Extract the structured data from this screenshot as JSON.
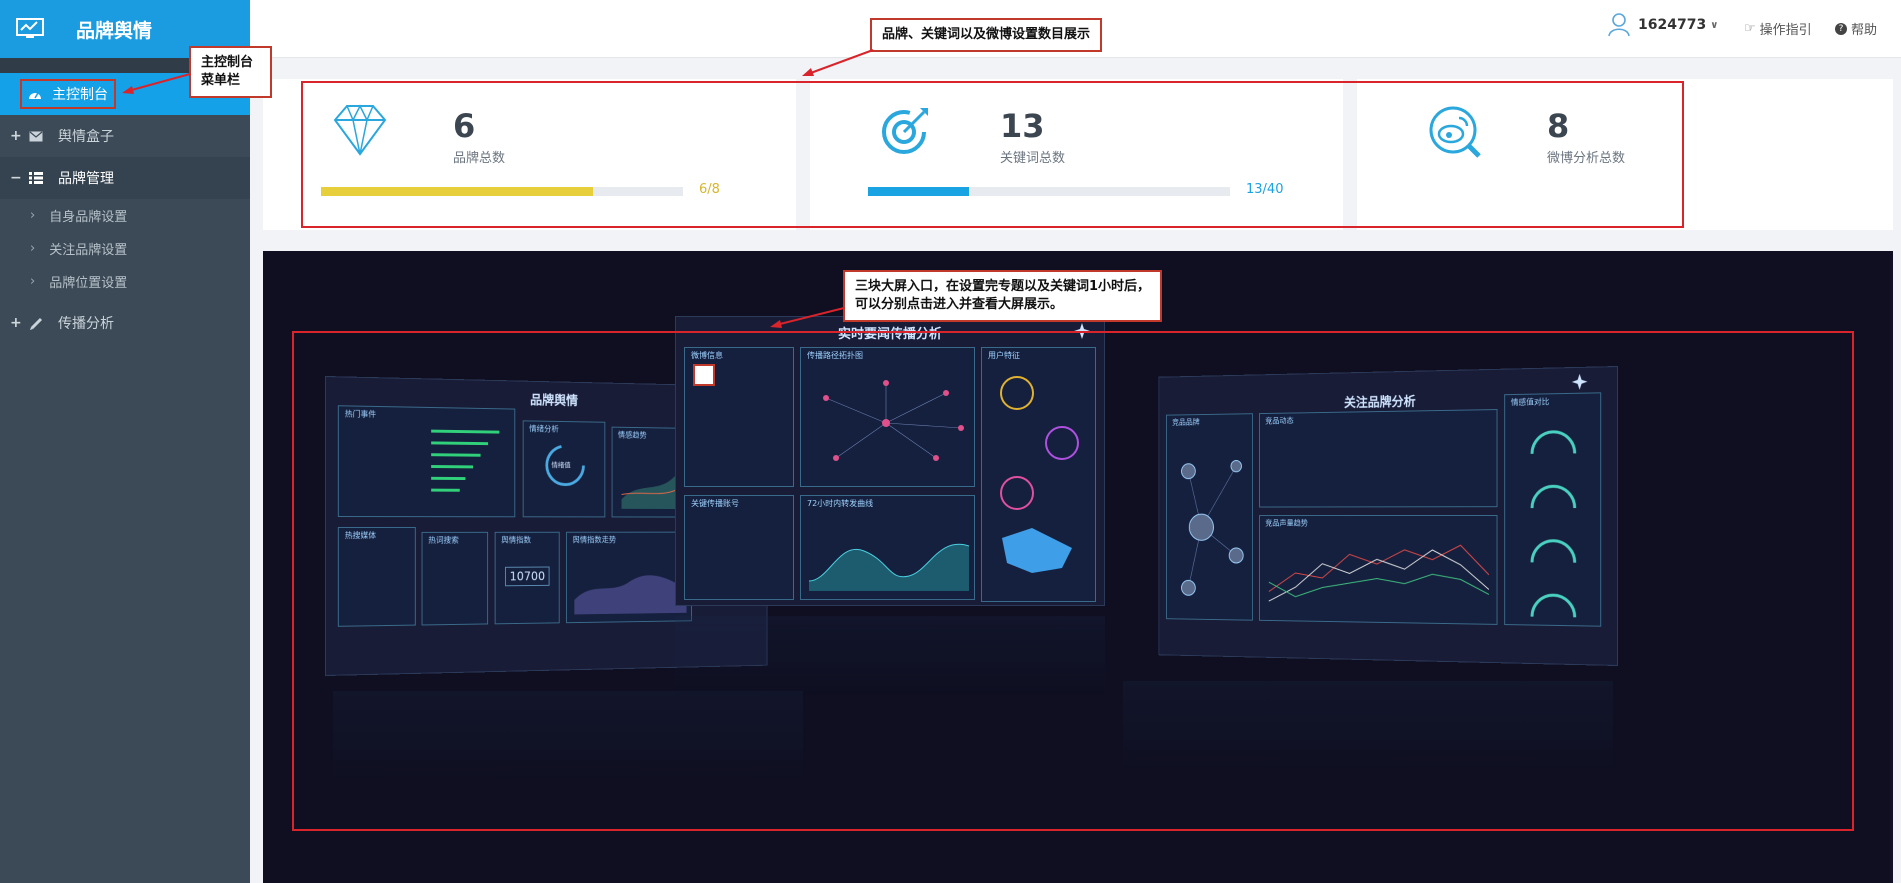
{
  "app": {
    "title": "品牌舆情"
  },
  "sidebar": {
    "items": [
      {
        "label": "主控制台",
        "active": true
      },
      {
        "label": "舆情盒子",
        "sign": "+"
      },
      {
        "label": "品牌管理",
        "sign": "−",
        "children": [
          "自身品牌设置",
          "关注品牌设置",
          "品牌位置设置"
        ]
      },
      {
        "label": "传播分析",
        "sign": "+"
      }
    ]
  },
  "header": {
    "user": "1624773",
    "guide_label": "操作指引",
    "help_label": "帮助"
  },
  "stats": [
    {
      "value": "6",
      "label": "品牌总数",
      "ratio": "6/8",
      "progress": 0.75,
      "color": "#e6cf3a",
      "ratio_color": "#d7b62d"
    },
    {
      "value": "13",
      "label": "关键词总数",
      "ratio": "13/40",
      "progress": 0.28,
      "color": "#1aa3e2",
      "ratio_color": "#1aa3e2"
    },
    {
      "value": "8",
      "label": "微博分析总数"
    }
  ],
  "annotations": {
    "sidebar_note": [
      "主控制台",
      "菜单栏"
    ],
    "stats_note": "品牌、关键词以及微博设置数目展示",
    "screens_note": [
      "三块大屏入口，在设置完专题以及关键词1小时后，",
      "可以分别点击进入并查看大屏展示。"
    ]
  },
  "screens": [
    {
      "title": "品牌舆情",
      "panels": [
        "热门事件",
        "情绪分析",
        "情感趋势",
        "热搜媒体",
        "热词搜索",
        "舆情指数",
        "舆情指数走势"
      ],
      "gauge_label": "情绪值",
      "big_number": "10700"
    },
    {
      "title": "实时要闻传播分析",
      "panels": [
        "微博信息",
        "传播路径拓扑图",
        "用户特征",
        "关键传播账号",
        "72小时内转发曲线"
      ]
    },
    {
      "title": "关注品牌分析",
      "panels": [
        "竞品品牌",
        "竞品动态",
        "竞品声量趋势",
        "情感值对比"
      ]
    }
  ],
  "colors": {
    "brand": "#1b9be0",
    "sidebar": "#3b4a56",
    "active": "#15a1e8",
    "annotation": "#d9242b"
  }
}
